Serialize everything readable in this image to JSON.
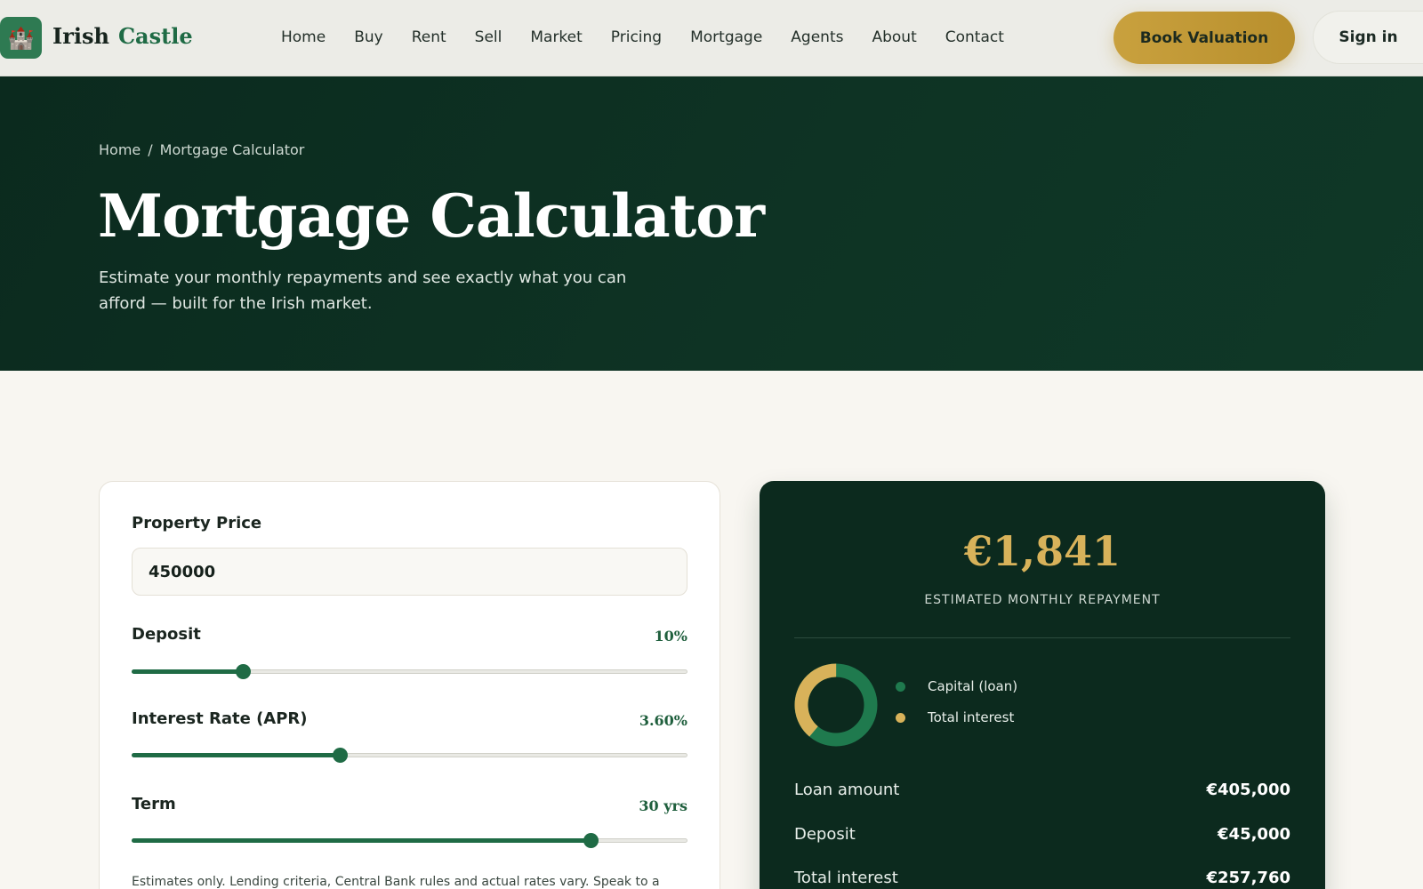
{
  "brand": {
    "name_part1": "Irish",
    "name_part2": "Castle",
    "logo_icon": "castle-icon",
    "logo_glyph": "🏰"
  },
  "nav": {
    "links": [
      "Home",
      "Buy",
      "Rent",
      "Sell",
      "Market",
      "Pricing",
      "Mortgage",
      "Agents",
      "About",
      "Contact"
    ],
    "cta_label": "Book Valuation",
    "signin_label": "Sign in"
  },
  "hero": {
    "breadcrumb": [
      "Home",
      "Mortgage Calculator"
    ],
    "breadcrumb_sep": "/",
    "title": "Mortgage Calculator",
    "subtitle": "Estimate your monthly repayments and see exactly what you can afford — built for the Irish market."
  },
  "form": {
    "property_price": {
      "label": "Property Price",
      "value": "450000"
    },
    "deposit": {
      "label": "Deposit",
      "display": "10%",
      "fraction": 0.2
    },
    "interest": {
      "label": "Interest Rate (APR)",
      "display": "3.60%",
      "fraction": 0.375
    },
    "term": {
      "label": "Term",
      "display": "30 yrs",
      "fraction": 0.825
    },
    "note": "Estimates only. Lending criteria, Central Bank rules and actual rates vary. Speak to a"
  },
  "result": {
    "monthly": "€1,841",
    "monthly_label": "ESTIMATED MONTHLY REPAYMENT",
    "legend": [
      {
        "label": "Capital (loan)",
        "color": "#1f7a4e"
      },
      {
        "label": "Total interest",
        "color": "#d8b25a"
      }
    ],
    "breakdown": {
      "capital": 405000,
      "interest": 257760
    },
    "rows": [
      {
        "label": "Loan amount",
        "value": "€405,000"
      },
      {
        "label": "Deposit",
        "value": "€45,000"
      },
      {
        "label": "Total interest",
        "value": "€257,760"
      }
    ]
  },
  "colors": {
    "primary_green": "#1f6b45",
    "dark_green": "#0c2a1e",
    "gold": "#d8b25a"
  }
}
